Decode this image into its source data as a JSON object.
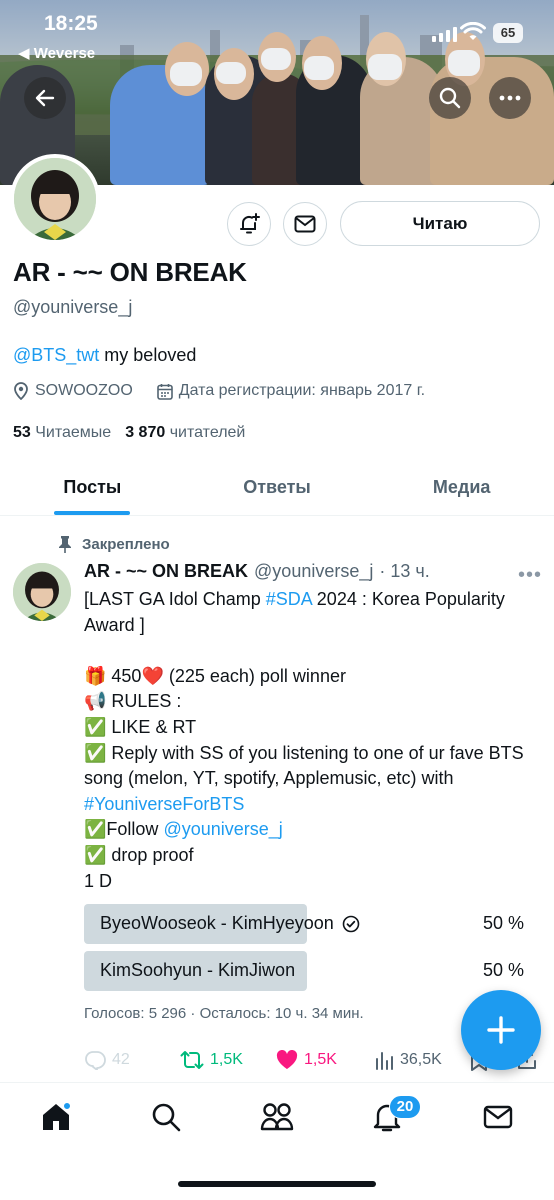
{
  "status_bar": {
    "time": "18:25",
    "back_app": "◀ Weverse",
    "battery": "65"
  },
  "profile": {
    "display_name": "AR - ~~ ON BREAK",
    "handle": "@youniverse_j",
    "bio_link": "@BTS_twt",
    "bio_text": " my beloved",
    "location": "SOWOOZOO",
    "joined": "Дата регистрации: январь 2017 г.",
    "following_count": "53",
    "following_label": "Читаемые",
    "followers_count": "3 870",
    "followers_label": "читателей",
    "follow_button": "Читаю"
  },
  "tabs": [
    {
      "label": "Посты",
      "active": true
    },
    {
      "label": "Ответы",
      "active": false
    },
    {
      "label": "Медиа",
      "active": false
    }
  ],
  "post": {
    "pinned_label": "Закреплено",
    "name": "AR - ~~ ON BREAK",
    "handle": "@youniverse_j",
    "time": "· 13 ч.",
    "line1_a": "[LAST GA Idol Champ ",
    "line1_tag": "#SDA",
    "line1_b": " 2024 : Korea Popularity Award ]",
    "line2": "🎁 450❤️ (225 each) poll winner",
    "line3": "📢 RULES :",
    "line4": "✅ LIKE & RT",
    "line5": "✅ Reply with SS of you listening to one of ur fave BTS song (melon, YT, spotify, Applemusic, etc) with ",
    "line5_tag": "#YouniverseForBTS",
    "line6_a": "✅Follow ",
    "line6_tag": "@youniverse_j",
    "line7": "✅ drop proof",
    "line8": "1 D",
    "poll": [
      {
        "label": "ByeoWooseok - KimHyeyoon",
        "percent": "50 %",
        "fill": 0.5,
        "selected": true
      },
      {
        "label": "KimSoohyun - KimJiwon",
        "percent": "50 %",
        "fill": 0.5,
        "selected": false
      }
    ],
    "poll_meta": "Голосов: 5 296 · Осталось: 10 ч. 34 мин.",
    "replies": "42",
    "reposts": "1,5K",
    "likes": "1,5K",
    "views": "36,5K"
  },
  "nav": {
    "notifications_badge": "20"
  },
  "colors": {
    "accent": "#1d9bf0",
    "repost": "#00ba7c",
    "like": "#f91880",
    "secondary_text": "#536471"
  }
}
